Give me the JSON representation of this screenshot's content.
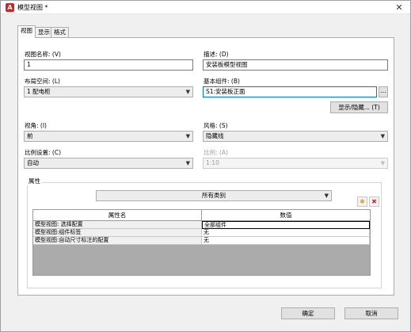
{
  "window": {
    "title": "模型视图 *",
    "close_glyph": "✕"
  },
  "tabs": [
    {
      "label": "视图"
    },
    {
      "label": "显示"
    },
    {
      "label": "格式"
    }
  ],
  "form": {
    "view_name": {
      "label": "视图名称: (V)",
      "value": "1"
    },
    "description": {
      "label": "描述: (D)",
      "value": "安装板模型视图"
    },
    "layout_space": {
      "label": "布局空间: (L)",
      "value": "1 配电柜"
    },
    "base_component": {
      "label": "基本组件: (B)",
      "value": "S1:安装板正面",
      "browse_label": "..."
    },
    "show_hide_button": "显示/隐藏... (T)",
    "view_angle": {
      "label": "视角: (I)",
      "value": "前"
    },
    "style": {
      "label": "风格: (S)",
      "value": "隐藏线"
    },
    "scale_setting": {
      "label": "比例设置: (C)",
      "value": "自动"
    },
    "scale": {
      "label": "比例: (A)",
      "value": "1:10"
    }
  },
  "properties": {
    "group_label": "属性",
    "filter": "所有类别",
    "add_icon": "✱",
    "delete_icon": "✖",
    "columns": [
      "属性名",
      "数值"
    ],
    "rows": [
      {
        "name": "模型视图: 选择配置",
        "value": "全部组件"
      },
      {
        "name": "模型视图:组件标签",
        "value": "无"
      },
      {
        "name": "模型视图:自动尺寸标注的配置",
        "value": "无"
      }
    ]
  },
  "buttons": {
    "ok": "确定",
    "cancel": "取消"
  }
}
